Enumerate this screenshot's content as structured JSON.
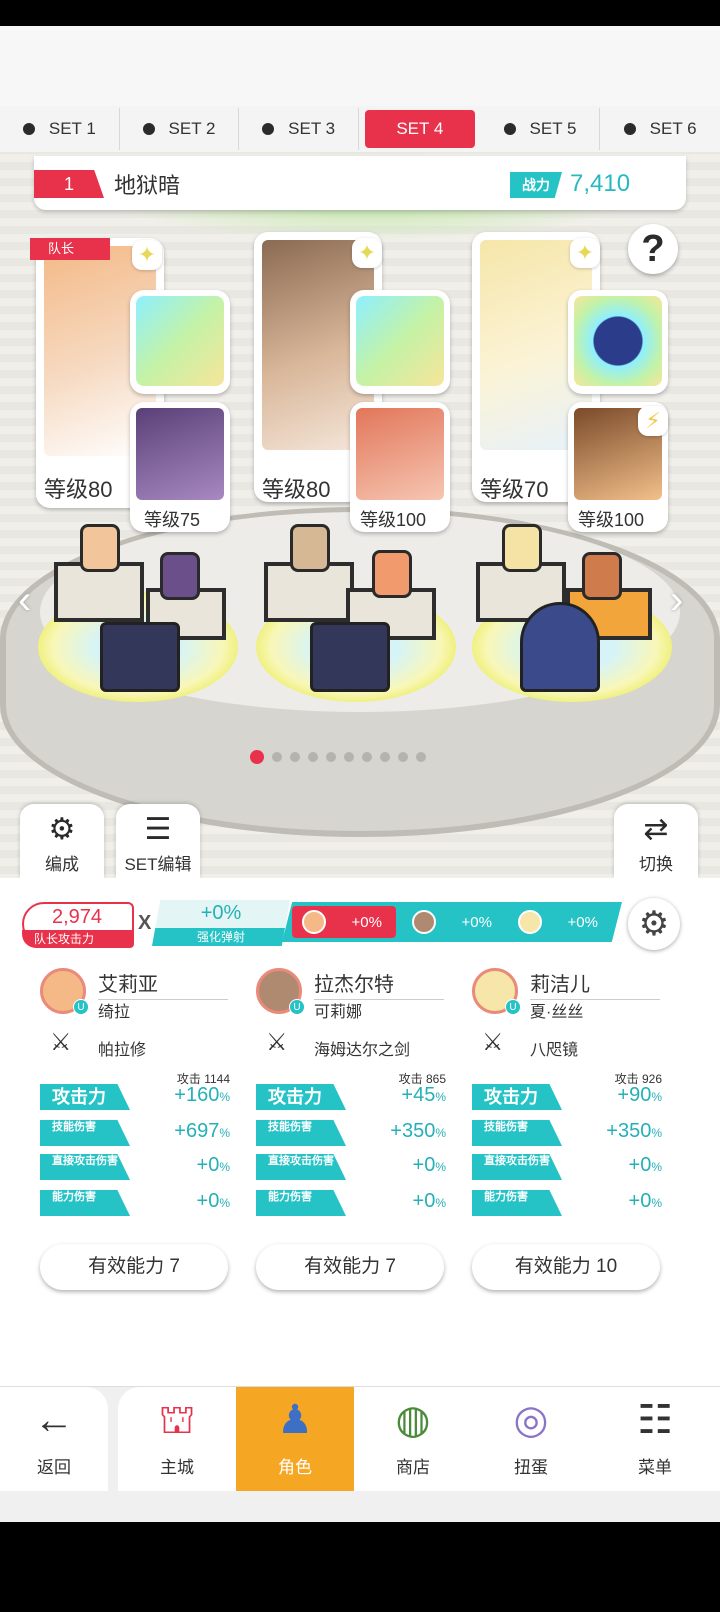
{
  "set_tabs": [
    "SET 1",
    "SET 2",
    "SET 3",
    "SET 4",
    "SET 5",
    "SET 6"
  ],
  "active_set": "SET 4",
  "team": {
    "number": "1",
    "name": "地狱暗",
    "power_label": "战力",
    "power_value": "7,410"
  },
  "help": "?",
  "leader_tag": "队长",
  "party": [
    {
      "main_level": "等级80",
      "sub_level": "等级75"
    },
    {
      "main_level": "等级80",
      "sub_level": "等级100"
    },
    {
      "main_level": "等级70",
      "sub_level": "等级100"
    }
  ],
  "scene_buttons": {
    "formation": "编成",
    "set_edit": "SET编辑",
    "switch": "切换"
  },
  "leader_attack": {
    "value": "2,974",
    "label": "队长攻击力"
  },
  "multiplier": "X",
  "bounce": {
    "value": "+0%",
    "label": "强化弹射"
  },
  "bonuses": [
    "+0%",
    "+0%",
    "+0%"
  ],
  "heroes": [
    {
      "name": "艾莉亚",
      "sub": "绮拉",
      "weapon": "帕拉修",
      "atk_base": "攻击 1144",
      "stats": [
        {
          "label": "攻击力",
          "value": "+160",
          "unit": "%"
        },
        {
          "label": "技能伤害",
          "value": "+697",
          "unit": "%"
        },
        {
          "label": "直接攻击伤害",
          "value": "+0",
          "unit": "%"
        },
        {
          "label": "能力伤害",
          "value": "+0",
          "unit": "%"
        }
      ],
      "effective": "有效能力 7"
    },
    {
      "name": "拉杰尔特",
      "sub": "可莉娜",
      "weapon": "海姆达尔之剑",
      "atk_base": "攻击 865",
      "stats": [
        {
          "label": "攻击力",
          "value": "+45",
          "unit": "%"
        },
        {
          "label": "技能伤害",
          "value": "+350",
          "unit": "%"
        },
        {
          "label": "直接攻击伤害",
          "value": "+0",
          "unit": "%"
        },
        {
          "label": "能力伤害",
          "value": "+0",
          "unit": "%"
        }
      ],
      "effective": "有效能力 7"
    },
    {
      "name": "莉洁儿",
      "sub": "夏·丝丝",
      "weapon": "八咫镜",
      "atk_base": "攻击 926",
      "stats": [
        {
          "label": "攻击力",
          "value": "+90",
          "unit": "%"
        },
        {
          "label": "技能伤害",
          "value": "+350",
          "unit": "%"
        },
        {
          "label": "直接攻击伤害",
          "value": "+0",
          "unit": "%"
        },
        {
          "label": "能力伤害",
          "value": "+0",
          "unit": "%"
        }
      ],
      "effective": "有效能力 10"
    }
  ],
  "nav": [
    "返回",
    "主城",
    "角色",
    "商店",
    "扭蛋",
    "菜单"
  ],
  "active_nav": "角色",
  "colors": {
    "accent_red": "#e8324b",
    "teal": "#25c2c6",
    "nav_active": "#f5a623"
  }
}
